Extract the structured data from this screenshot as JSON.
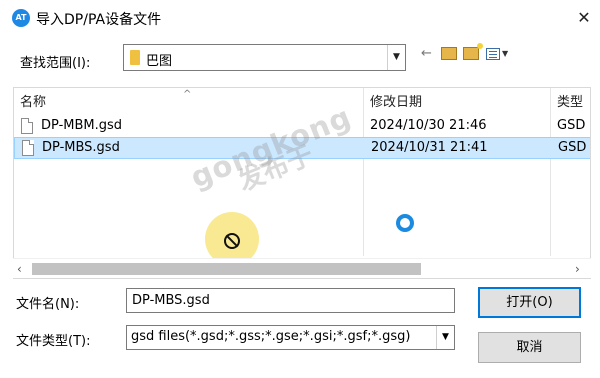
{
  "dialog": {
    "title": "导入DP/PA设备文件",
    "app_icon_text": "AT",
    "close_glyph": "✕"
  },
  "look_in": {
    "label": "查找范围(I):",
    "value": "巴图"
  },
  "toolbar": {
    "icons": [
      "back-arrow-icon",
      "up-folder-icon",
      "new-folder-icon",
      "view-menu-icon"
    ]
  },
  "file_list": {
    "columns": [
      "名称",
      "修改日期",
      "类型"
    ],
    "rows": [
      {
        "name": "DP-MBM.gsd",
        "date": "2024/10/30 21:46",
        "type": "GSD"
      },
      {
        "name": "DP-MBS.gsd",
        "date": "2024/10/31 21:41",
        "type": "GSD"
      }
    ],
    "selected_index": 1
  },
  "watermark": {
    "latin": "gongkong",
    "cn": "发布于"
  },
  "file_name": {
    "label": "文件名(N):",
    "value": "DP-MBS.gsd"
  },
  "file_type": {
    "label": "文件类型(T):",
    "value": "gsd files(*.gsd;*.gss;*.gse;*.gsi;*.gsf;*.gsg)"
  },
  "buttons": {
    "open": "打开(O)",
    "cancel": "取消"
  },
  "colors": {
    "selection_bg": "#cce8ff",
    "selection_border": "#99d1ff",
    "default_button_border": "#0078d7"
  }
}
